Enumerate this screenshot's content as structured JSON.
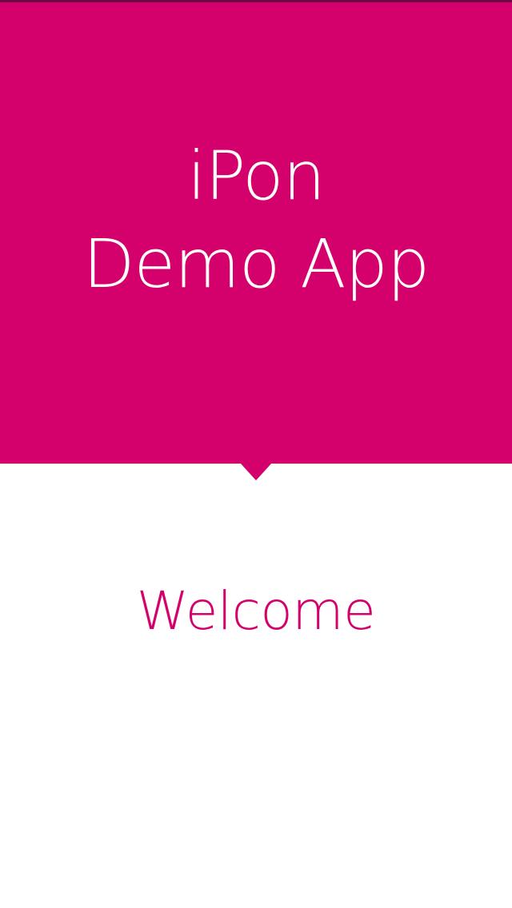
{
  "app": {
    "title_line1": "iPon",
    "title_line2": "Demo App"
  },
  "main": {
    "welcome_text": "Welcome"
  },
  "colors": {
    "brand": "#d4006c",
    "background": "#ffffff",
    "text_on_brand": "#ffffff"
  }
}
